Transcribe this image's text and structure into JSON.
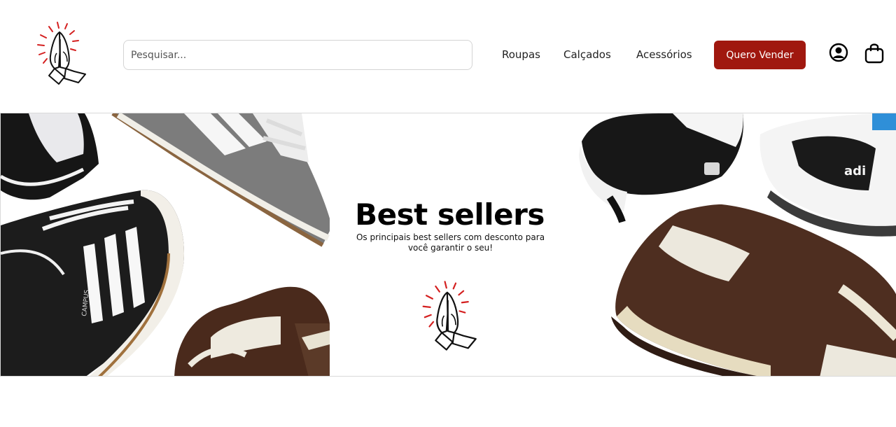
{
  "header": {
    "logo_icon": "praying-hands-icon",
    "search": {
      "placeholder": "Pesquisar...",
      "value": ""
    },
    "nav": [
      {
        "label": "Roupas"
      },
      {
        "label": "Calçados"
      },
      {
        "label": "Acessórios"
      }
    ],
    "sell_button": "Quero Vender",
    "user_icon": "user-circle-icon",
    "cart_icon": "shopping-bag-icon"
  },
  "banner": {
    "title": "Best sellers",
    "subtitle": "Os principais best sellers com desconto para você garantir o seu!",
    "logo_icon": "praying-hands-icon"
  },
  "colors": {
    "accent": "#a0180f",
    "ray_red": "#d42020",
    "text": "#111111"
  }
}
